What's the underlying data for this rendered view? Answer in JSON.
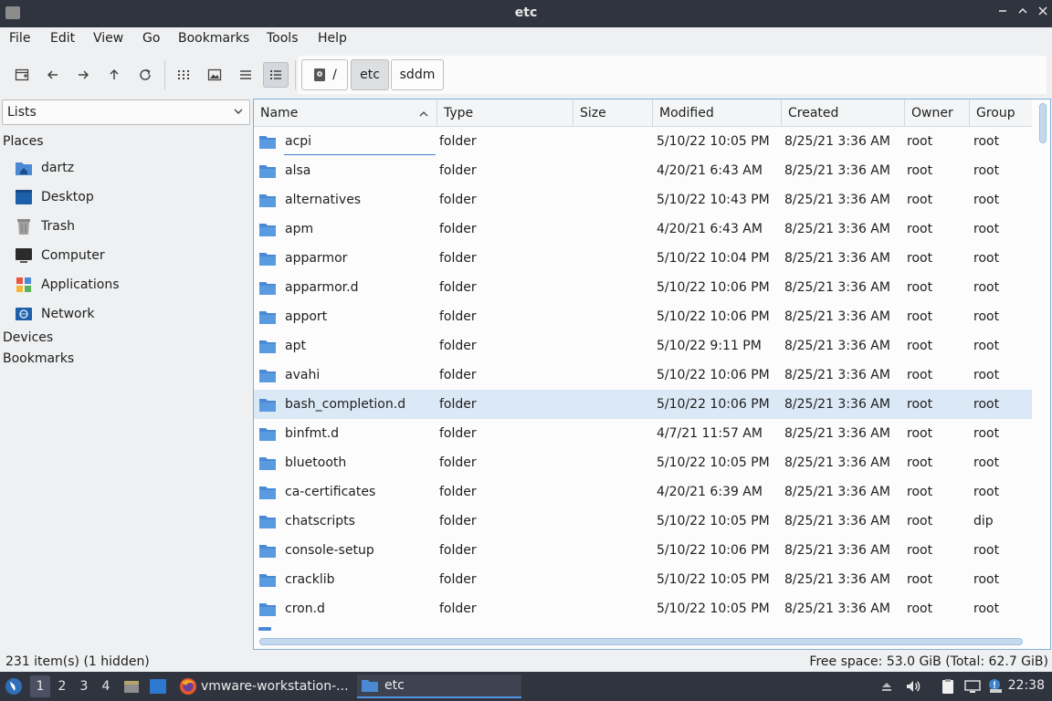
{
  "window": {
    "title": "etc"
  },
  "menu": [
    "File",
    "Edit",
    "View",
    "Go",
    "Bookmarks",
    "Tools",
    "Help"
  ],
  "breadcrumb": {
    "root": "/",
    "items": [
      "etc",
      "sddm"
    ]
  },
  "sidebar": {
    "selector": "Lists",
    "places_label": "Places",
    "places": [
      {
        "label": "dartz",
        "icon": "home-folder-icon"
      },
      {
        "label": "Desktop",
        "icon": "desktop-icon"
      },
      {
        "label": "Trash",
        "icon": "trash-icon"
      },
      {
        "label": "Computer",
        "icon": "computer-icon"
      },
      {
        "label": "Applications",
        "icon": "applications-icon"
      },
      {
        "label": "Network",
        "icon": "network-icon"
      }
    ],
    "devices_label": "Devices",
    "bookmarks_label": "Bookmarks"
  },
  "columns": [
    "Name",
    "Type",
    "Size",
    "Modified",
    "Created",
    "Owner",
    "Group"
  ],
  "files": [
    {
      "name": "acpi",
      "type": "folder",
      "size": "",
      "modified": "5/10/22 10:05 PM",
      "created": "8/25/21 3:36 AM",
      "owner": "root",
      "group": "root"
    },
    {
      "name": "alsa",
      "type": "folder",
      "size": "",
      "modified": "4/20/21 6:43 AM",
      "created": "8/25/21 3:36 AM",
      "owner": "root",
      "group": "root"
    },
    {
      "name": "alternatives",
      "type": "folder",
      "size": "",
      "modified": "5/10/22 10:43 PM",
      "created": "8/25/21 3:36 AM",
      "owner": "root",
      "group": "root"
    },
    {
      "name": "apm",
      "type": "folder",
      "size": "",
      "modified": "4/20/21 6:43 AM",
      "created": "8/25/21 3:36 AM",
      "owner": "root",
      "group": "root"
    },
    {
      "name": "apparmor",
      "type": "folder",
      "size": "",
      "modified": "5/10/22 10:04 PM",
      "created": "8/25/21 3:36 AM",
      "owner": "root",
      "group": "root"
    },
    {
      "name": "apparmor.d",
      "type": "folder",
      "size": "",
      "modified": "5/10/22 10:06 PM",
      "created": "8/25/21 3:36 AM",
      "owner": "root",
      "group": "root"
    },
    {
      "name": "apport",
      "type": "folder",
      "size": "",
      "modified": "5/10/22 10:06 PM",
      "created": "8/25/21 3:36 AM",
      "owner": "root",
      "group": "root"
    },
    {
      "name": "apt",
      "type": "folder",
      "size": "",
      "modified": "5/10/22 9:11 PM",
      "created": "8/25/21 3:36 AM",
      "owner": "root",
      "group": "root"
    },
    {
      "name": "avahi",
      "type": "folder",
      "size": "",
      "modified": "5/10/22 10:06 PM",
      "created": "8/25/21 3:36 AM",
      "owner": "root",
      "group": "root"
    },
    {
      "name": "bash_completion.d",
      "type": "folder",
      "size": "",
      "modified": "5/10/22 10:06 PM",
      "created": "8/25/21 3:36 AM",
      "owner": "root",
      "group": "root",
      "selected": true
    },
    {
      "name": "binfmt.d",
      "type": "folder",
      "size": "",
      "modified": "4/7/21 11:57 AM",
      "created": "8/25/21 3:36 AM",
      "owner": "root",
      "group": "root"
    },
    {
      "name": "bluetooth",
      "type": "folder",
      "size": "",
      "modified": "5/10/22 10:05 PM",
      "created": "8/25/21 3:36 AM",
      "owner": "root",
      "group": "root"
    },
    {
      "name": "ca-certificates",
      "type": "folder",
      "size": "",
      "modified": "4/20/21 6:39 AM",
      "created": "8/25/21 3:36 AM",
      "owner": "root",
      "group": "root"
    },
    {
      "name": "chatscripts",
      "type": "folder",
      "size": "",
      "modified": "5/10/22 10:05 PM",
      "created": "8/25/21 3:36 AM",
      "owner": "root",
      "group": "dip"
    },
    {
      "name": "console-setup",
      "type": "folder",
      "size": "",
      "modified": "5/10/22 10:06 PM",
      "created": "8/25/21 3:36 AM",
      "owner": "root",
      "group": "root"
    },
    {
      "name": "cracklib",
      "type": "folder",
      "size": "",
      "modified": "5/10/22 10:05 PM",
      "created": "8/25/21 3:36 AM",
      "owner": "root",
      "group": "root"
    },
    {
      "name": "cron.d",
      "type": "folder",
      "size": "",
      "modified": "5/10/22 10:05 PM",
      "created": "8/25/21 3:36 AM",
      "owner": "root",
      "group": "root"
    }
  ],
  "status": {
    "left": "231 item(s) (1 hidden)",
    "right": "Free space: 53.0 GiB (Total: 62.7 GiB)"
  },
  "taskbar": {
    "workspaces": [
      "1",
      "2",
      "3",
      "4"
    ],
    "tasks": [
      {
        "label": "vmware-workstation-...",
        "icon": "firefox-icon"
      },
      {
        "label": "etc",
        "icon": "folder-icon"
      }
    ],
    "clock": "22:38"
  },
  "colors": {
    "accent": "#3b83c6",
    "folder": "#4a8ad4",
    "titlebar": "#2f343f",
    "selection": "#dbe8f6"
  }
}
